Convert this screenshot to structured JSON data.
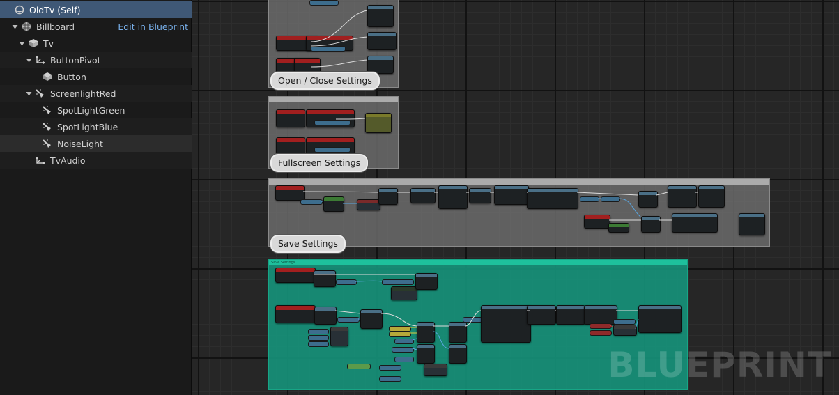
{
  "tree": {
    "rows": [
      {
        "label": "OldTv (Self)",
        "icon": "actor-icon",
        "arrow": "none",
        "indent": 0,
        "state": "selected"
      },
      {
        "label": "Billboard",
        "icon": "billboard-icon",
        "arrow": "down",
        "indent": 1,
        "state": "normal",
        "link": "Edit in Blueprint"
      },
      {
        "label": "Tv",
        "icon": "static-mesh-icon",
        "arrow": "down",
        "indent": 2,
        "state": "normal"
      },
      {
        "label": "ButtonPivot",
        "icon": "scene-icon",
        "arrow": "down",
        "indent": 3,
        "state": "alt"
      },
      {
        "label": "Button",
        "icon": "static-mesh-icon",
        "arrow": "none",
        "indent": 4,
        "state": "normal"
      },
      {
        "label": "ScreenlightRed",
        "icon": "spotlight-icon",
        "arrow": "down",
        "indent": 3,
        "state": "alt"
      },
      {
        "label": "SpotLightGreen",
        "icon": "spotlight-icon",
        "arrow": "none",
        "indent": 4,
        "state": "normal"
      },
      {
        "label": "SpotLightBlue",
        "icon": "spotlight-icon",
        "arrow": "none",
        "indent": 4,
        "state": "alt"
      },
      {
        "label": "NoiseLight",
        "icon": "spotlight-icon",
        "arrow": "none",
        "indent": 4,
        "state": "hovered"
      },
      {
        "label": "TvAudio",
        "icon": "audio-icon",
        "arrow": "none",
        "indent": 3,
        "state": "alt"
      }
    ]
  },
  "graph": {
    "comments": {
      "open_close": "Open / Close Settings",
      "fullscreen": "Fullscreen Settings",
      "save": "Save Settings"
    },
    "watermark": "BLUEPRINT"
  }
}
